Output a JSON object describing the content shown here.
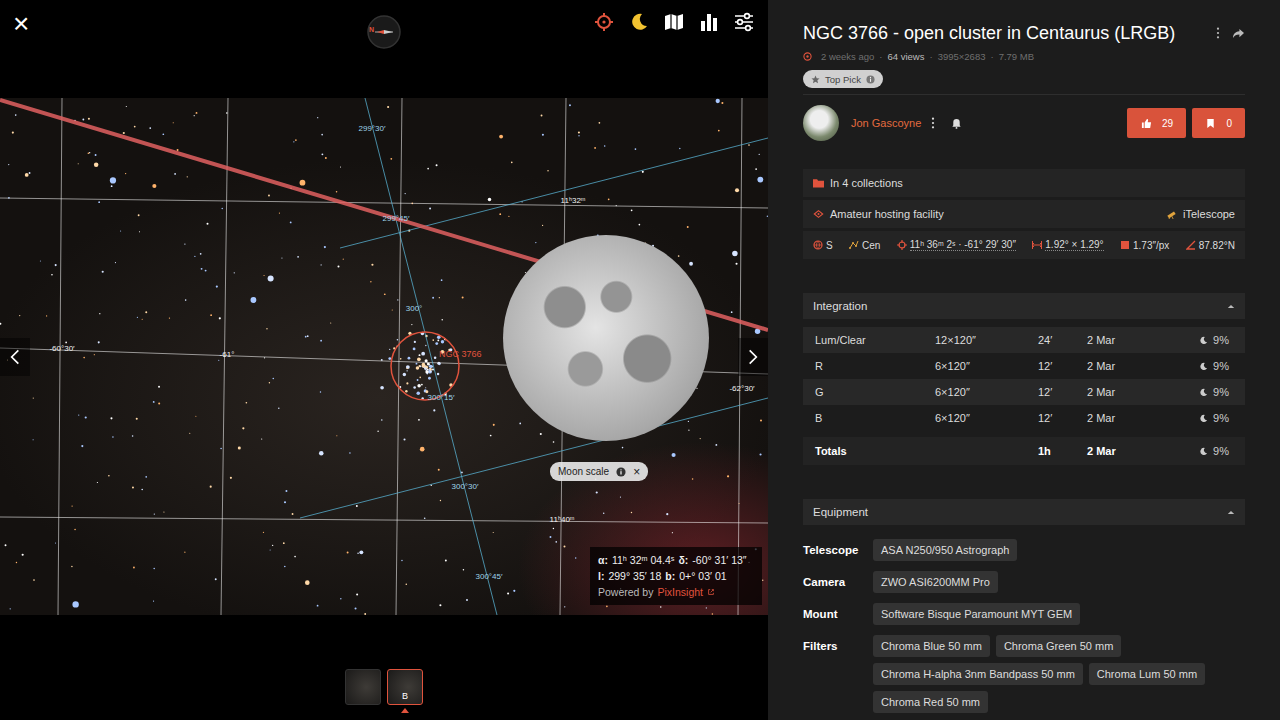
{
  "viewer": {
    "close": "×",
    "compass": "N",
    "tools": [
      {
        "kind": "crosshair",
        "color": "#e0533d"
      },
      {
        "kind": "moon",
        "color": "#f2c230"
      },
      {
        "kind": "map",
        "color": "#ffffff"
      },
      {
        "kind": "chart",
        "color": "#ffffff"
      },
      {
        "kind": "sliders",
        "color": "#ffffff"
      }
    ],
    "grid_labels": [
      "299°30′",
      "299°45′",
      "11ʰ32ᵐ",
      "300°",
      "-60°30′",
      "-61°",
      "300°15′",
      "300°30′",
      "11ʰ40ᵐ",
      "300°45′",
      "-62°30′"
    ],
    "target": "NGC 3766",
    "moon_scale": {
      "label": "Moon scale",
      "close": "×"
    },
    "coords": {
      "ra_label": "α:",
      "ra": "11ʰ 32ᵐ 04.4ˢ",
      "dec_label": "δ:",
      "dec": "-60° 31′ 13″",
      "l_label": "l:",
      "l": "299° 35′ 18",
      "b_label": "b:",
      "b": "0+° 03′ 01"
    },
    "powered": {
      "text": "Powered by",
      "link": "PixInsight"
    },
    "thumbnails": [
      {
        "selected": false
      },
      {
        "label": "B",
        "selected": true
      }
    ]
  },
  "panel": {
    "title": "NGC 3766 - open cluster in Centaurus (LRGB)",
    "meta": [
      "2 weeks ago",
      "64 views",
      "3995×2683",
      "7.79 MB"
    ],
    "separator": "·",
    "badge": "Top Pick",
    "user": {
      "name": "Jon Gascoyne",
      "likes": "29",
      "bookmarks": "0"
    },
    "collections": "In 4 collections",
    "hosting": {
      "label": "Amateur hosting facility",
      "value": "iTelescope"
    },
    "astrometry": [
      {
        "kind": "hemisphere",
        "text": "S"
      },
      {
        "kind": "constellation",
        "text": "Cen"
      },
      {
        "kind": "coordinates",
        "text": "11ʰ 36ᵐ 2ˢ · -61° 29′ 30″"
      },
      {
        "kind": "field",
        "text": "1.92° × 1.29°"
      },
      {
        "kind": "scale",
        "text": "1.73″/px"
      },
      {
        "kind": "orientation",
        "text": "87.82°N"
      }
    ],
    "integration": {
      "title": "Integration",
      "expanded": true,
      "rows": [
        {
          "filter": "Lum/Clear",
          "frames": "12×120″",
          "duration": "24′",
          "date": "2 Mar",
          "moon": "9%"
        },
        {
          "filter": "R",
          "frames": "6×120″",
          "duration": "12′",
          "date": "2 Mar",
          "moon": "9%"
        },
        {
          "filter": "G",
          "frames": "6×120″",
          "duration": "12′",
          "date": "2 Mar",
          "moon": "9%"
        },
        {
          "filter": "B",
          "frames": "6×120″",
          "duration": "12′",
          "date": "2 Mar",
          "moon": "9%"
        }
      ],
      "totals": {
        "label": "Totals",
        "duration": "1h",
        "date": "2 Mar",
        "moon": "9%"
      }
    },
    "equipment": {
      "title": "Equipment",
      "expanded": true,
      "rows": [
        {
          "label": "Telescope",
          "items": [
            "ASA N250/950 Astrograph"
          ]
        },
        {
          "label": "Camera",
          "items": [
            "ZWO ASI6200MM Pro"
          ]
        },
        {
          "label": "Mount",
          "items": [
            "Software Bisque Paramount MYT GEM"
          ]
        },
        {
          "label": "Filters",
          "items": [
            "Chroma Blue 50 mm",
            "Chroma Green 50 mm",
            "Chroma H-alpha 3nm Bandpass 50 mm",
            "Chroma Lum 50 mm",
            "Chroma Red 50 mm"
          ]
        }
      ]
    }
  }
}
